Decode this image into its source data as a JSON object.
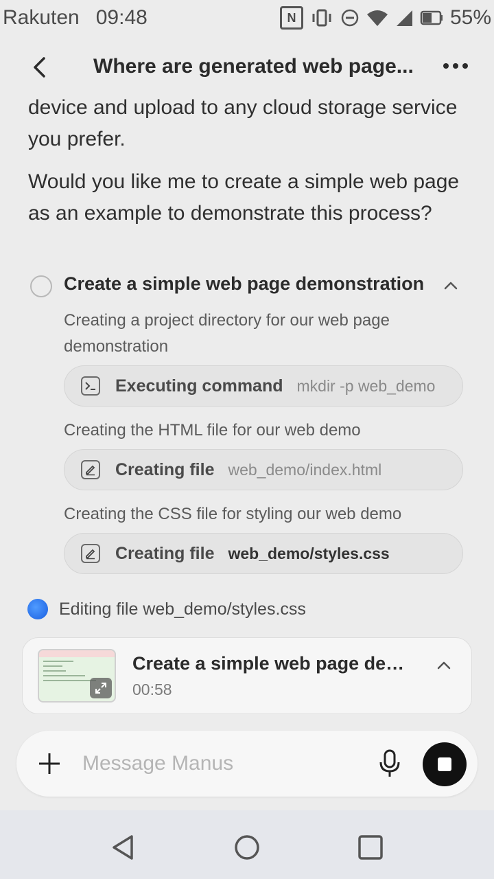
{
  "status_bar": {
    "carrier": "Rakuten",
    "time": "09:48",
    "battery": "55%",
    "icons": [
      "nfc-icon",
      "vibrate-icon",
      "do-not-disturb-icon",
      "wifi-icon",
      "signal-icon",
      "battery-icon"
    ]
  },
  "header": {
    "title": "Where are generated web page...",
    "back_icon": "back-chevron-icon",
    "more_icon": "more-dots-icon"
  },
  "chat": {
    "paragraph_1": "device and upload to any cloud storage service you prefer.",
    "paragraph_2": "Would you like me to create a simple web page as an example to demonstrate this process?"
  },
  "task": {
    "title": "Create a simple web page demonstration",
    "steps": [
      {
        "text": "Creating a project directory for our web page demonstration",
        "action_label": "Executing command",
        "action_arg": "mkdir -p web_demo",
        "icon": "terminal-icon"
      },
      {
        "text": "Creating the HTML file for our web demo",
        "action_label": "Creating file",
        "action_arg": "web_demo/index.html",
        "icon": "edit-file-icon"
      },
      {
        "text": "Creating the CSS file for styling our web demo",
        "action_label": "Creating file",
        "action_arg": "web_demo/styles.css",
        "icon": "edit-file-icon"
      }
    ]
  },
  "editing_status": {
    "text": "Editing file web_demo/styles.css"
  },
  "task_card": {
    "title": "Create a simple web page demonstration",
    "time": "00:58"
  },
  "composer": {
    "placeholder": "Message Manus"
  },
  "colors": {
    "background": "#ececec",
    "accent_blue": "#1a5fe0",
    "stop_button": "#111111"
  }
}
